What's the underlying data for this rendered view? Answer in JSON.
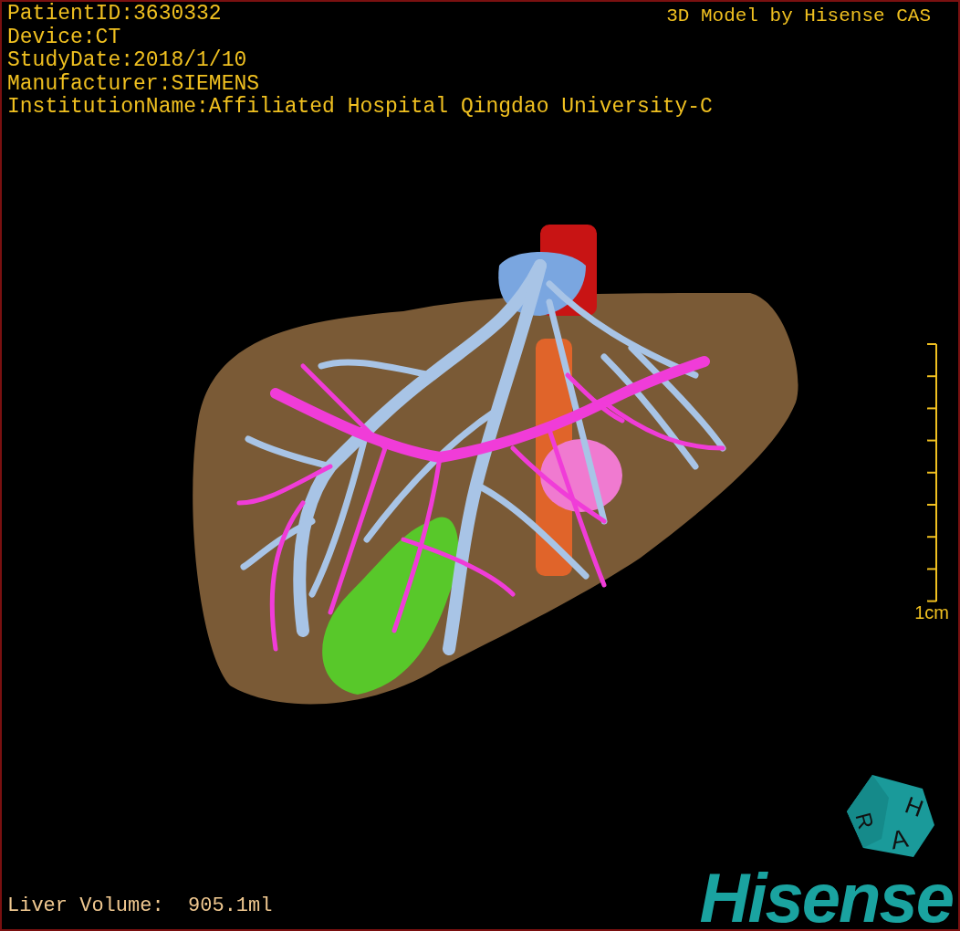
{
  "info_lines": [
    "PatientID:3630332",
    "Device:CT",
    "StudyDate:2018/1/10",
    "Manufacturer:SIEMENS",
    "InstitutionName:Affiliated Hospital Qingdao University-C"
  ],
  "viewer_title": "3D Model by Hisense CAS",
  "scale_bar": {
    "label": "1cm"
  },
  "liver_volume": "Liver Volume:  905.1ml",
  "orientation_cube": {
    "labels": [
      "H",
      "R",
      "A"
    ]
  },
  "logo": "Hisense"
}
